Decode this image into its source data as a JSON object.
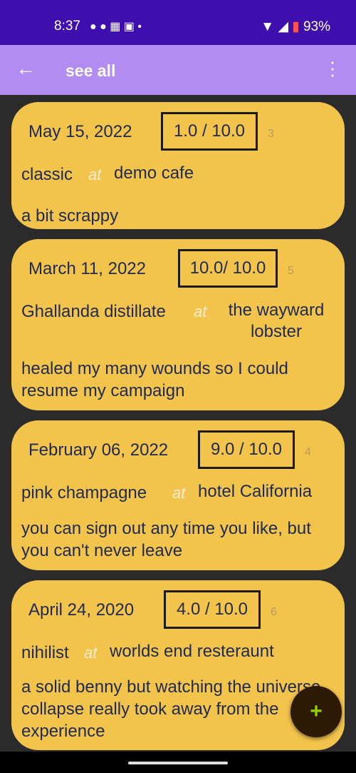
{
  "status_bar": {
    "time": "8:37",
    "notification_icons": "● ● ▦ ▣ •",
    "battery_percent": "93%"
  },
  "app_bar": {
    "back_icon": "←",
    "title": "see all",
    "more_icon": "⋮"
  },
  "entries": [
    {
      "date": "May 15,  2022",
      "rating": "1.0  / 10.0",
      "count": "3",
      "drink": "classic",
      "at": "at",
      "place": "demo cafe",
      "note": "a bit scrappy"
    },
    {
      "date": "March 11,  2022",
      "rating": "10.0/ 10.0",
      "count": "5",
      "drink": "Ghallanda distillate",
      "at": "at",
      "place": "the wayward lobster",
      "note": "healed my many wounds so I could resume my campaign"
    },
    {
      "date": "February 06,  2022",
      "rating": "9.0  / 10.0",
      "count": "4",
      "drink": "pink champagne",
      "at": "at",
      "place": "hotel California",
      "note": "you can sign out any time you like, but you can't never leave"
    },
    {
      "date": "April 24,  2020",
      "rating": "4.0  / 10.0",
      "count": "6",
      "drink": "nihilist",
      "at": "at",
      "place": "worlds end resteraunt",
      "note": "a solid benny but watching the universe collapse really took away from the experience"
    }
  ],
  "fab": {
    "icon": "+"
  },
  "colors": {
    "status_bar": "#3f0fae",
    "app_bar": "#b38cf2",
    "card": "#f3c44c",
    "background": "#2b2b2b",
    "fab": "#2c1a05",
    "fab_icon": "#8fd400"
  }
}
